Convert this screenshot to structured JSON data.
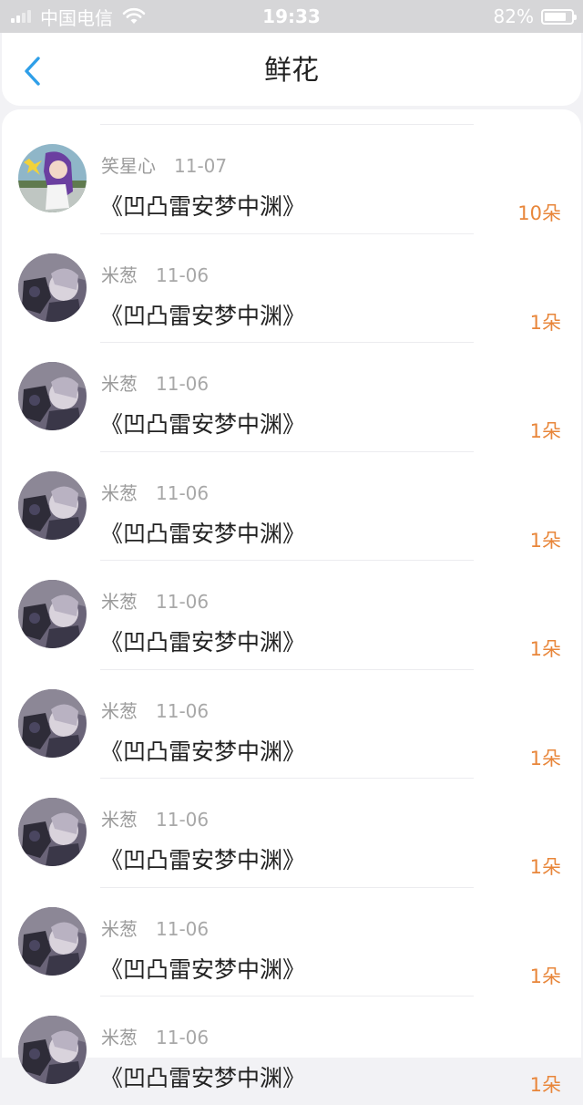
{
  "status_bar": {
    "carrier": "中国电信",
    "time": "19:33",
    "battery": "82%",
    "battery_level": 0.82,
    "signal_bars": 2,
    "icons": [
      "signal-icon",
      "wifi-icon",
      "battery-icon"
    ]
  },
  "header": {
    "back_icon": "back-chevron-icon",
    "title": "鲜花"
  },
  "colors": {
    "accent": "#2f9fe8",
    "count_orange": "#e8863a",
    "text_primary": "#222222",
    "text_secondary": "#9b9b9b"
  },
  "items": [
    {
      "user": "笑星心",
      "date": "11-07",
      "book": "《凹凸雷安梦中渊》",
      "count": "10朵",
      "avatar": "avatar-purple-hair"
    },
    {
      "user": "米葱",
      "date": "11-06",
      "book": "《凹凸雷安梦中渊》",
      "count": "1朵",
      "avatar": "avatar-anime-dark"
    },
    {
      "user": "米葱",
      "date": "11-06",
      "book": "《凹凸雷安梦中渊》",
      "count": "1朵",
      "avatar": "avatar-anime-dark"
    },
    {
      "user": "米葱",
      "date": "11-06",
      "book": "《凹凸雷安梦中渊》",
      "count": "1朵",
      "avatar": "avatar-anime-dark"
    },
    {
      "user": "米葱",
      "date": "11-06",
      "book": "《凹凸雷安梦中渊》",
      "count": "1朵",
      "avatar": "avatar-anime-dark"
    },
    {
      "user": "米葱",
      "date": "11-06",
      "book": "《凹凸雷安梦中渊》",
      "count": "1朵",
      "avatar": "avatar-anime-dark"
    },
    {
      "user": "米葱",
      "date": "11-06",
      "book": "《凹凸雷安梦中渊》",
      "count": "1朵",
      "avatar": "avatar-anime-dark"
    },
    {
      "user": "米葱",
      "date": "11-06",
      "book": "《凹凸雷安梦中渊》",
      "count": "1朵",
      "avatar": "avatar-anime-dark"
    },
    {
      "user": "米葱",
      "date": "11-06",
      "book": "《凹凸雷安梦中渊》",
      "count": "1朵",
      "avatar": "avatar-anime-dark"
    }
  ]
}
